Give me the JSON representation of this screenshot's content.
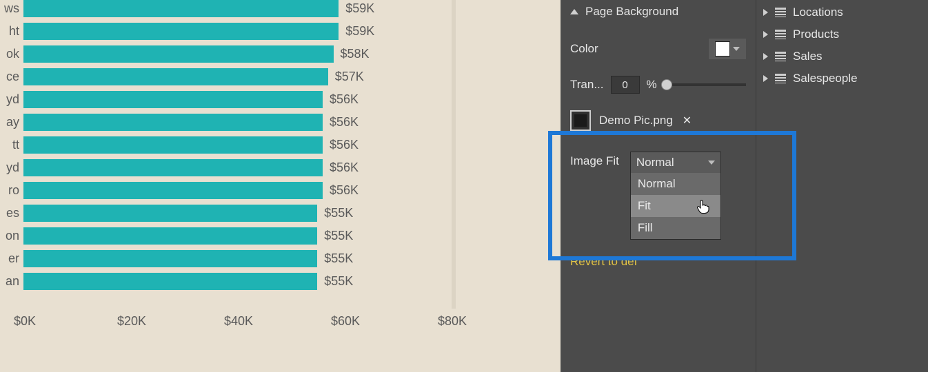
{
  "chart_data": {
    "type": "bar",
    "orientation": "horizontal",
    "xlabel": "",
    "ylabel": "",
    "xlim": [
      0,
      80
    ],
    "unit_prefix": "$",
    "unit_suffix": "K",
    "x_ticks": [
      "$0K",
      "$20K",
      "$40K",
      "$60K",
      "$80K"
    ],
    "categories": [
      "ws",
      "ht",
      "ok",
      "ce",
      "yd",
      "ay",
      "tt",
      "yd",
      "ro",
      "es",
      "on",
      "er",
      "an"
    ],
    "values": [
      59,
      59,
      58,
      57,
      56,
      56,
      56,
      56,
      56,
      55,
      55,
      55,
      55
    ],
    "value_labels": [
      "$59K",
      "$59K",
      "$58K",
      "$57K",
      "$56K",
      "$56K",
      "$56K",
      "$56K",
      "$56K",
      "$55K",
      "$55K",
      "$55K",
      "$55K"
    ],
    "bar_color": "#1fb3b3"
  },
  "format": {
    "group_title": "Page Background",
    "color_label": "Color",
    "color_value": "#FFFFFF",
    "transparency_label": "Tran...",
    "transparency_value": "0",
    "transparency_unit": "%",
    "image_file": "Demo Pic.png",
    "image_fit_label": "Image Fit",
    "image_fit_selected": "Normal",
    "image_fit_options": [
      "Normal",
      "Fit",
      "Fill"
    ],
    "image_fit_hover_index": 1,
    "revert_label": "Revert to def"
  },
  "fields": {
    "items": [
      {
        "label": "Locations"
      },
      {
        "label": "Products"
      },
      {
        "label": "Sales"
      },
      {
        "label": "Salespeople"
      }
    ]
  }
}
